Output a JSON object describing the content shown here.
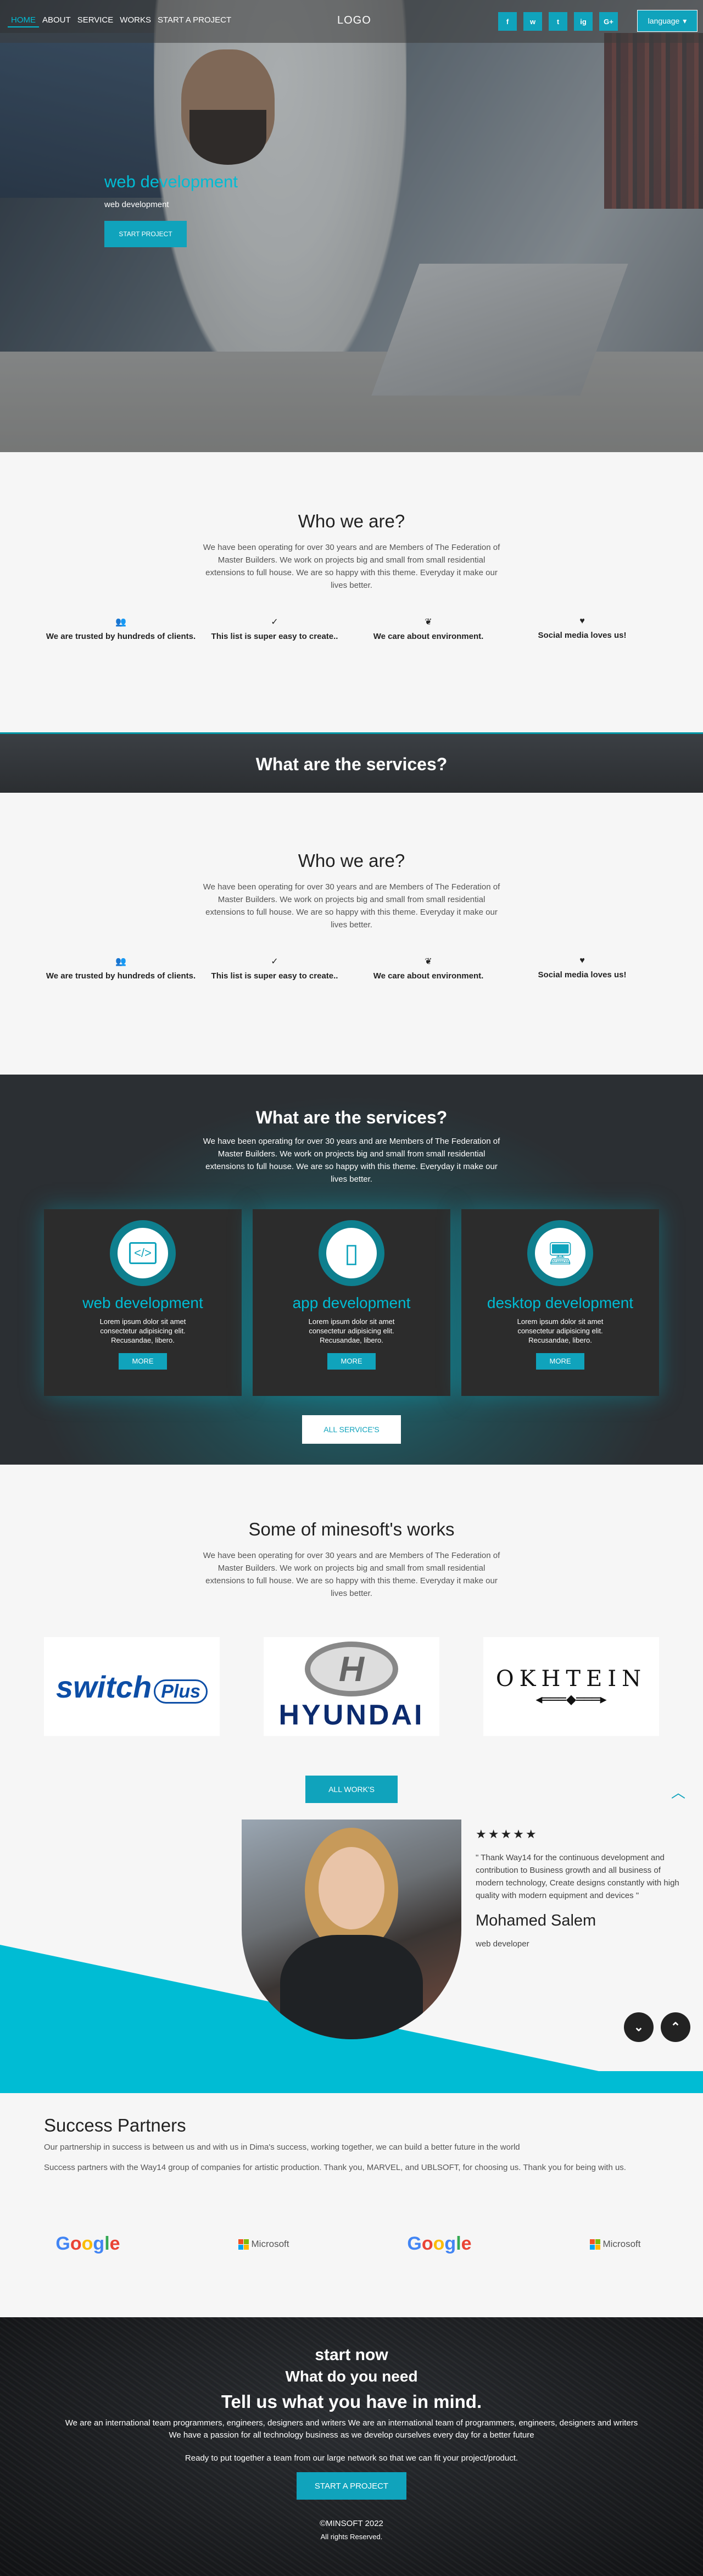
{
  "nav": {
    "links": [
      "HOME",
      "ABOUT",
      "SERVICE",
      "WORKS",
      "START A PROJECT"
    ],
    "logo": "LOGO",
    "socials": [
      "f",
      "w",
      "t",
      "ig",
      "G+"
    ],
    "language_label": "language",
    "language_icon": "chevron-down-icon"
  },
  "hero": {
    "title": "web development",
    "subtitle": "web development",
    "cta": "START PROJECT"
  },
  "about": [
    {
      "title": "Who we are?",
      "text": "We have been operating for over 30 years and are Members of The Federation of Master Builders. We work on projects big and small from small residential extensions to full house. We are so happy with this theme. Everyday it make our lives better.",
      "features": [
        {
          "icon": "users-icon",
          "glyph": "👥",
          "label": "We are trusted by hundreds of clients."
        },
        {
          "icon": "check-icon",
          "glyph": "✓",
          "label": "This list is super easy to create.."
        },
        {
          "icon": "leaf-icon",
          "glyph": "❦",
          "label": "We care about environment."
        },
        {
          "icon": "heart-icon",
          "glyph": "♥",
          "label": "Social media loves us!"
        }
      ]
    },
    {
      "title": "Who we are?",
      "text": "We have been operating for over 30 years and are Members of The Federation of Master Builders. We work on projects big and small from small residential extensions to full house. We are so happy with this theme. Everyday it make our lives better.",
      "features": [
        {
          "icon": "users-icon",
          "glyph": "👥",
          "label": "We are trusted by hundreds of clients."
        },
        {
          "icon": "check-icon",
          "glyph": "✓",
          "label": "This list is super easy to create.."
        },
        {
          "icon": "leaf-icon",
          "glyph": "❦",
          "label": "We care about environment."
        },
        {
          "icon": "heart-icon",
          "glyph": "♥",
          "label": "Social media loves us!"
        }
      ]
    }
  ],
  "banner": {
    "title": "What are the services?"
  },
  "services": {
    "title": "What are the services?",
    "text": "We have been operating for over 30 years and are Members of The Federation of Master Builders. We work on projects big and small from small residential extensions to full house. We are so happy with this theme. Everyday it make our lives better.",
    "cards": [
      {
        "icon": "code-monitor-icon",
        "glyph": "</>",
        "title": "web development",
        "text": "Lorem ipsum dolor sit amet consectetur adipisicing elit. Recusandae, libero.",
        "more": "MORE"
      },
      {
        "icon": "mobile-icon",
        "glyph": "▯",
        "title": "app development",
        "text": "Lorem ipsum dolor sit amet consectetur adipisicing elit. Recusandae, libero.",
        "more": "MORE"
      },
      {
        "icon": "desktop-icon",
        "glyph": "🖥",
        "title": "desktop development",
        "text": "Lorem ipsum dolor sit amet consectetur adipisicing elit. Recusandae, libero.",
        "more": "MORE"
      }
    ],
    "all_button": "ALL SERVICE'S"
  },
  "works": {
    "title": "Some of minesoft's works",
    "text": "We have been operating for over 30 years and are Members of The Federation of Master Builders. We work on projects big and small from small residential extensions to full house. We are so happy with this theme. Everyday it make our lives better.",
    "logos": {
      "switch_main": "switch",
      "switch_plus": "Plus",
      "hyundai": "HYUNDAI",
      "okhtein": "OKHTEIN"
    },
    "all_button": "ALL WORK'S"
  },
  "testimonial": {
    "stars": "★★★★★",
    "quote": "\" Thank Way14 for the continuous development and contribution to Business growth and all business of modern technology, Create designs constantly with high quality with modern equipment and devices \"",
    "name": "Mohamed Salem",
    "role": "web developer"
  },
  "partners": {
    "title": "Success Partners",
    "line1": "Our partnership in success is between us and with us in Dima's success, working together, we can build a better future in the world",
    "line2": "Success partners with the Way14 group of companies for artistic production. Thank you, MARVEL, and UBLSOFT, for choosing us. Thank you for being with us.",
    "logos": [
      {
        "type": "google",
        "label": "Google"
      },
      {
        "type": "microsoft",
        "label": "Microsoft"
      },
      {
        "type": "google",
        "label": "Google"
      },
      {
        "type": "microsoft",
        "label": "Microsoft"
      }
    ]
  },
  "footer": {
    "heading1": "start now",
    "heading2": "What do you need",
    "heading3": "Tell us what you have in mind.",
    "line1": "We are an international team programmers, engineers, designers and writers We are an international team of programmers, engineers, designers and writers",
    "line2": "We have a passion for all technology business as we develop ourselves every day for a better future",
    "line3": "Ready to put together a team from our large network so that we can fit your project/product.",
    "cta": "START A PROJECT",
    "copyright": "©MINSOFT 2022",
    "rights": "All rights Reserved."
  },
  "colors": {
    "accent": "#10a3bc",
    "accent_light": "#00bcd4",
    "dark": "#2b2e31"
  }
}
